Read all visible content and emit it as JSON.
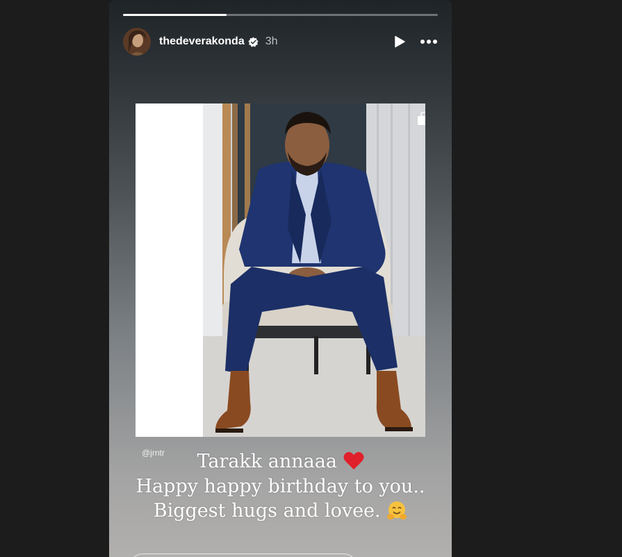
{
  "story": {
    "progress": 0.33,
    "username": "thedeverakonda",
    "time": "3h",
    "mention": "@jrntr",
    "caption": {
      "line1": "Tarakk annaaa",
      "line1_emoji": "❤️",
      "line2": "Happy happy birthday to you..",
      "line3": "Biggest hugs and lovee.",
      "line3_emoji": "🤗"
    }
  },
  "icons": {
    "verified": "verified-badge-icon",
    "play": "play-icon",
    "more": "more-options-icon",
    "multi": "multi-post-icon"
  }
}
